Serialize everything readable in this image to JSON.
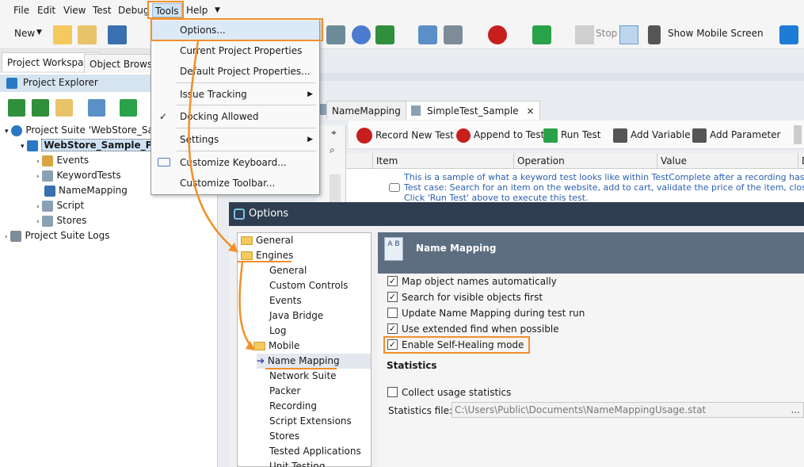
{
  "menubar": [
    "File",
    "Edit",
    "View",
    "Test",
    "Debug",
    "Tools",
    "Help"
  ],
  "toolbar": {
    "new_label": "New",
    "stop_label": "Stop",
    "mobile_label": "Show Mobile Screen"
  },
  "left_tabs": [
    "Project Workspace",
    "Object Browser"
  ],
  "explorer_title": "Project Explorer",
  "tree": {
    "suite": "Project Suite 'WebStore_Sampl",
    "project": "WebStore_Sample_Pro",
    "items": [
      "Events",
      "KeywordTests",
      "NameMapping",
      "Script",
      "Stores"
    ],
    "logs": "Project Suite Logs"
  },
  "tools_menu": {
    "items": [
      "Options...",
      "Current Project Properties",
      "Default Project Properties...",
      "Issue Tracking",
      "Docking Allowed",
      "Settings",
      "Customize Keyboard...",
      "Customize Toolbar..."
    ]
  },
  "doc_tabs": [
    "NameMapping",
    "SimpleTest_Sample"
  ],
  "kw_toolbar": [
    "Record New Test",
    "Append to Test",
    "Run Test",
    "Add Variable",
    "Add Parameter"
  ],
  "grid": {
    "columns": [
      "Item",
      "Operation",
      "Value",
      "D"
    ],
    "comment_lines": [
      "This is a sample of what a keyword test looks like within TestComplete after a recording has been done. P",
      "Test case: Search for an item on the website, add to cart, validate the price of the item, close the browse",
      "Click 'Run Test' above to execute this test."
    ]
  },
  "dialog": {
    "title": "Options",
    "tree": [
      "General",
      "Engines",
      "General",
      "Custom Controls",
      "Events",
      "Java Bridge",
      "Log",
      "Mobile",
      "Name Mapping",
      "Network Suite",
      "Packer",
      "Recording",
      "Script Extensions",
      "Stores",
      "Tested Applications",
      "Unit Testing"
    ],
    "section_title": "Name Mapping",
    "icon_text": "A B",
    "options": [
      {
        "label": "Map object names automatically",
        "checked": true
      },
      {
        "label": "Search for visible objects first",
        "checked": true
      },
      {
        "label": "Update Name Mapping during test run",
        "checked": false
      },
      {
        "label": "Use extended find when possible",
        "checked": true
      },
      {
        "label": "Enable Self-Healing mode",
        "checked": true
      }
    ],
    "stats_heading": "Statistics",
    "collect_label": "Collect usage statistics",
    "stats_file_label": "Statistics file:",
    "stats_file_value": "C:\\Users\\Public\\Documents\\NameMappingUsage.stat",
    "check_mark": "✓",
    "browse_dots": "..."
  },
  "colors": {
    "highlight": "#f0902a",
    "dialog_title": "#2e3d4f",
    "section_head": "#5c6e80"
  }
}
